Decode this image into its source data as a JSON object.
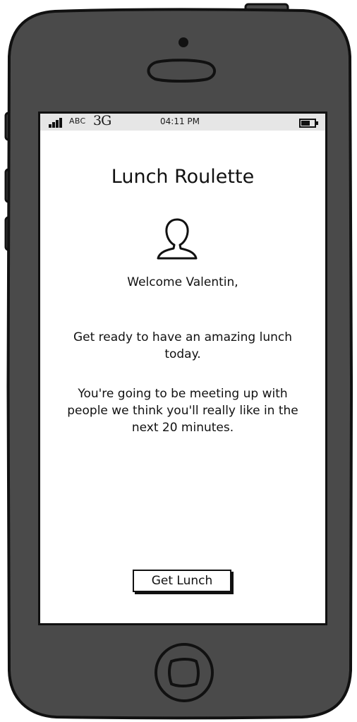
{
  "status_bar": {
    "carrier": "ABC",
    "network": "3G",
    "time": "04:11 PM"
  },
  "app": {
    "title": "Lunch Roulette",
    "welcome": "Welcome Valentin,",
    "intro": "Get ready to have an amazing lunch today.",
    "details": "You're going to be meeting up with people we think you'll really like in the next 20 minutes.",
    "get_lunch_label": "Get Lunch"
  },
  "icons": {
    "signal": "signal-bars-icon",
    "battery": "battery-icon",
    "avatar": "user-avatar-icon",
    "camera": "camera-icon",
    "speaker": "speaker-slot-icon",
    "home": "home-button-icon"
  },
  "colors": {
    "phone_body": "#4a4a4a",
    "outline": "#111111",
    "status_bar": "#e6e6e6",
    "screen": "#ffffff"
  }
}
